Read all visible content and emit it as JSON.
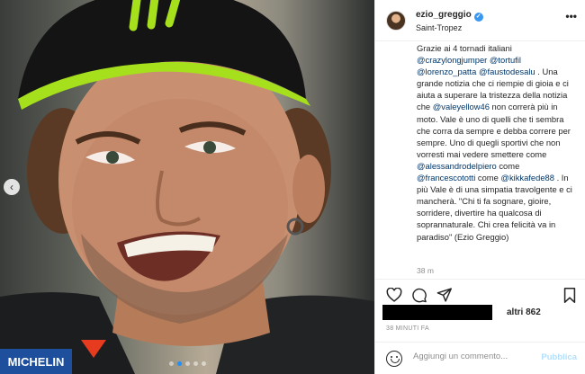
{
  "post": {
    "photo_label": "MICHELIN",
    "image_count": 5,
    "active_image": 1
  },
  "header": {
    "username": "ezio_greggio",
    "verified_icon": "verified-badge-icon",
    "location": "Saint-Tropez",
    "more_label": "•••"
  },
  "caption": {
    "parts": [
      {
        "t": "text",
        "v": "Grazie ai 4 tornadi italiani "
      },
      {
        "t": "mention",
        "v": "@crazylongjumper"
      },
      {
        "t": "text",
        "v": " "
      },
      {
        "t": "mention",
        "v": "@tortufil"
      },
      {
        "t": "text",
        "v": " "
      },
      {
        "t": "mention",
        "v": "@lorenzo_patta"
      },
      {
        "t": "text",
        "v": " "
      },
      {
        "t": "mention",
        "v": "@faustodesalu"
      },
      {
        "t": "text",
        "v": " . Una grande notizia che ci riempie di gioia e ci aiuta a superare la tristezza della notizia che "
      },
      {
        "t": "mention",
        "v": "@valeyellow46"
      },
      {
        "t": "text",
        "v": " non correrà più in moto. Vale è uno di quelli che ti sembra che corra da sempre e debba correre per sempre. Uno di quegli sportivi che non vorresti mai vedere smettere come "
      },
      {
        "t": "mention",
        "v": "@alessandrodelpiero"
      },
      {
        "t": "text",
        "v": " come "
      },
      {
        "t": "mention",
        "v": "@francescototti"
      },
      {
        "t": "text",
        "v": " come "
      },
      {
        "t": "mention",
        "v": "@kikkafede88"
      },
      {
        "t": "text",
        "v": " . In più Vale è di una simpatia travolgente e ci mancherà. \"Chi ti fa sognare, gioire, sorridere, divertire ha qualcosa di soprannaturale. Chi crea felicità va in paradiso\" (Ezio Greggio)"
      }
    ],
    "time_ago": "38 m"
  },
  "actions": {
    "like_icon": "heart-icon",
    "comment_icon": "comment-icon",
    "share_icon": "paper-plane-icon",
    "save_icon": "bookmark-icon"
  },
  "likes": {
    "text": "altri 862"
  },
  "posted": "38 MINUTI FA",
  "comment": {
    "placeholder": "Aggiungi un commento...",
    "publish_label": "Pubblica",
    "emoji_icon": "smiley-icon"
  },
  "colors": {
    "mention": "#00376b",
    "verified": "#3897f0",
    "publish_disabled": "#b2dffc",
    "helmet_green": "#a6e01c"
  }
}
